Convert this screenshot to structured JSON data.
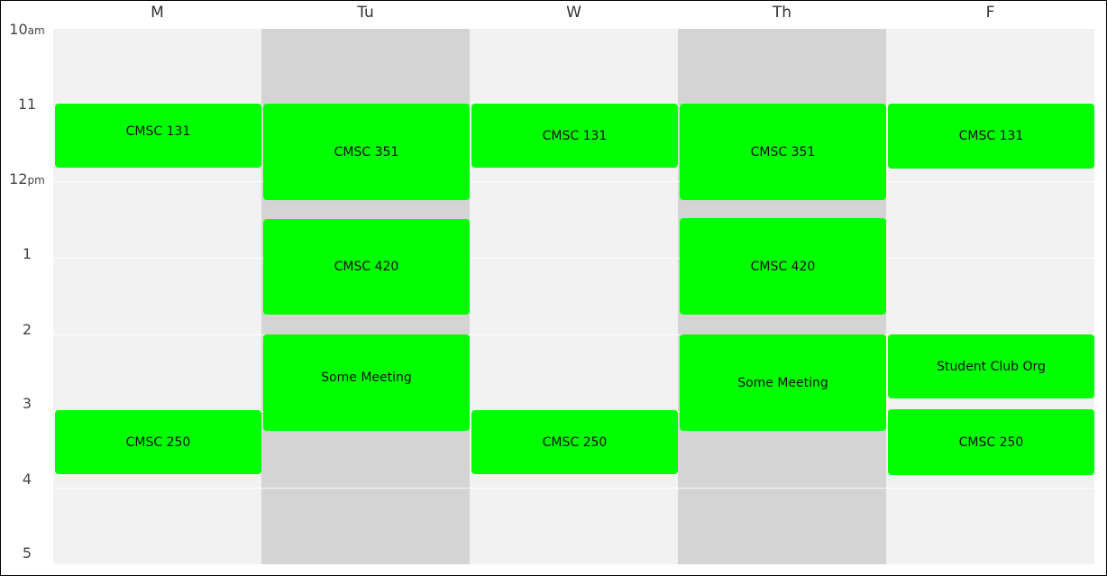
{
  "days": [
    "M",
    "Tu",
    "W",
    "Th",
    "F"
  ],
  "times": [
    {
      "hour": "10",
      "suffix": "am"
    },
    {
      "hour": "11",
      "suffix": ""
    },
    {
      "hour": "12",
      "suffix": "pm"
    },
    {
      "hour": "1",
      "suffix": ""
    },
    {
      "hour": "2",
      "suffix": ""
    },
    {
      "hour": "3",
      "suffix": ""
    },
    {
      "hour": "4",
      "suffix": ""
    },
    {
      "hour": "5",
      "suffix": ""
    }
  ],
  "events": {
    "mon_1": "CMSC 131",
    "mon_2": "CMSC 250",
    "tue_1": "CMSC 351",
    "tue_2": "CMSC 420",
    "tue_3": "Some Meeting",
    "wed_1": "CMSC 131",
    "wed_2": "CMSC 250",
    "thu_1": "CMSC 351",
    "thu_2": "CMSC 420",
    "thu_3": "Some Meeting",
    "fri_1": "CMSC 131",
    "fri_2": "Student Club Org",
    "fri_3": "CMSC 250"
  },
  "colors": {
    "event": "#00ff00",
    "column_light": "#f2f2f2",
    "column_dark": "#d4d4d4"
  }
}
